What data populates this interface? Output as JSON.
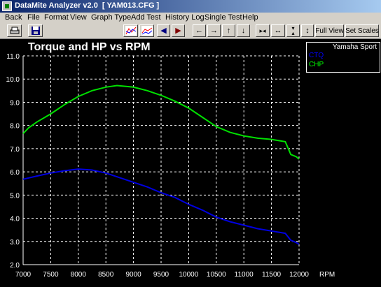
{
  "window": {
    "title": "DataMite Analyzer v2.0  [ YAM013.CFG ]"
  },
  "menu": [
    "Back",
    "File",
    "Format",
    "View",
    "Graph Type",
    "Add Test",
    "History Log",
    "Single Test",
    "Help"
  ],
  "toolbar": {
    "buttons": [
      {
        "name": "print-button",
        "icon": "printer-icon"
      },
      {
        "name": "save-button",
        "icon": "floppy-disk-icon"
      },
      {
        "name": "graph-type-1-button",
        "icon": "graph-icon"
      },
      {
        "name": "graph-type-2-button",
        "icon": "graph-icon"
      },
      {
        "name": "cursor-left-button",
        "icon": "arrow-left-icon"
      },
      {
        "name": "cursor-right-button",
        "icon": "arrow-right-icon"
      },
      {
        "name": "pan-left-button",
        "icon": "arrow-left-icon"
      },
      {
        "name": "pan-right-button",
        "icon": "arrow-right-icon"
      },
      {
        "name": "pan-up-button",
        "icon": "arrow-up-icon"
      },
      {
        "name": "pan-down-button",
        "icon": "arrow-down-icon"
      },
      {
        "name": "compress-x-button",
        "icon": "arrows-inward-icon"
      },
      {
        "name": "expand-x-button",
        "icon": "arrows-outward-icon"
      },
      {
        "name": "compress-y-button",
        "icon": "arrows-vertical-inward-icon"
      },
      {
        "name": "expand-y-button",
        "icon": "arrows-vertical-outward-icon"
      }
    ],
    "full_view_label": "Full View",
    "set_scales_label": "Set Scales"
  },
  "chart_data": {
    "type": "line",
    "title": "Torque and HP vs RPM",
    "xlabel": "RPM",
    "ylabel": "",
    "xlim": [
      7000,
      12000
    ],
    "ylim": [
      2.0,
      11.0
    ],
    "xticks": [
      7000,
      7500,
      8000,
      8500,
      9000,
      9500,
      10000,
      10500,
      11000,
      11500,
      12000
    ],
    "yticks": [
      "2.0",
      "3.0",
      "4.0",
      "5.0",
      "6.0",
      "7.0",
      "8.0",
      "9.0",
      "10.0",
      "11.0"
    ],
    "grid": true,
    "legend": {
      "title": "Yamaha Sport",
      "placement": "top-right",
      "entries": [
        {
          "label": "CTQ",
          "color": "#0000ff"
        },
        {
          "label": "CHP",
          "color": "#00ff00"
        }
      ]
    },
    "series": [
      {
        "name": "CHP",
        "color": "#00e000",
        "points": [
          [
            7000,
            7.65
          ],
          [
            7100,
            7.9
          ],
          [
            7250,
            8.15
          ],
          [
            7500,
            8.5
          ],
          [
            7750,
            8.9
          ],
          [
            8000,
            9.25
          ],
          [
            8250,
            9.5
          ],
          [
            8500,
            9.65
          ],
          [
            8700,
            9.72
          ],
          [
            9000,
            9.65
          ],
          [
            9250,
            9.5
          ],
          [
            9500,
            9.3
          ],
          [
            9750,
            9.05
          ],
          [
            10000,
            8.75
          ],
          [
            10250,
            8.35
          ],
          [
            10500,
            7.95
          ],
          [
            10750,
            7.7
          ],
          [
            11000,
            7.55
          ],
          [
            11250,
            7.45
          ],
          [
            11500,
            7.4
          ],
          [
            11750,
            7.3
          ],
          [
            11850,
            6.75
          ],
          [
            11950,
            6.65
          ],
          [
            12000,
            6.55
          ]
        ]
      },
      {
        "name": "CTQ",
        "color": "#0000e0",
        "points": [
          [
            7000,
            5.68
          ],
          [
            7250,
            5.82
          ],
          [
            7500,
            5.95
          ],
          [
            7750,
            6.05
          ],
          [
            8000,
            6.12
          ],
          [
            8250,
            6.08
          ],
          [
            8500,
            5.95
          ],
          [
            8750,
            5.75
          ],
          [
            9000,
            5.55
          ],
          [
            9250,
            5.35
          ],
          [
            9500,
            5.1
          ],
          [
            9750,
            4.9
          ],
          [
            10000,
            4.6
          ],
          [
            10250,
            4.35
          ],
          [
            10500,
            4.05
          ],
          [
            10750,
            3.85
          ],
          [
            11000,
            3.7
          ],
          [
            11250,
            3.55
          ],
          [
            11500,
            3.45
          ],
          [
            11750,
            3.35
          ],
          [
            11850,
            3.05
          ],
          [
            11950,
            2.95
          ],
          [
            12000,
            2.88
          ]
        ]
      }
    ]
  }
}
